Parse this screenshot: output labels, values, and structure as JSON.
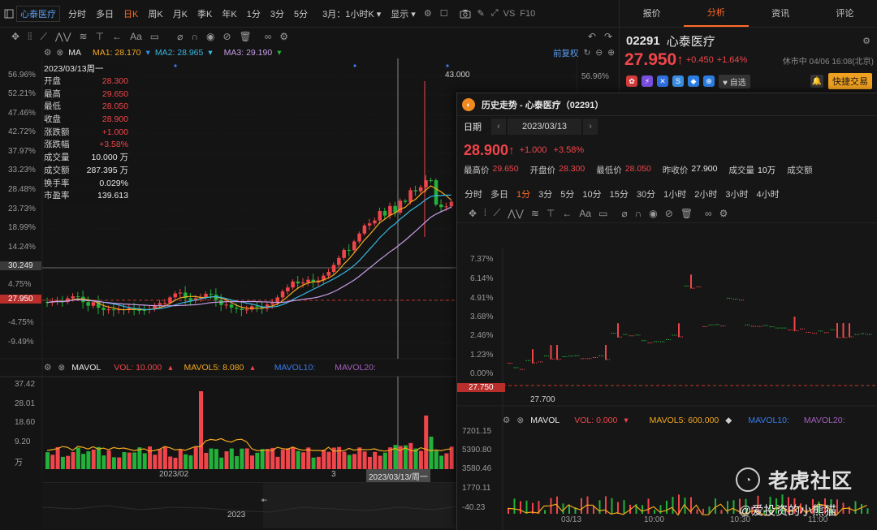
{
  "toolbar": {
    "stock_name": "心泰医疗",
    "periods": [
      "分时",
      "多日",
      "日K",
      "周K",
      "月K",
      "季K",
      "年K",
      "1分",
      "3分",
      "5分"
    ],
    "active_period": "日K",
    "range_select": "3月：1小时K",
    "display_label": "显示",
    "vs_label": "VS",
    "f10_label": "F10"
  },
  "indicators": {
    "ma_label": "MA",
    "ma1": "MA1: 28.170",
    "ma2": "MA2: 28.965",
    "ma3": "MA3: 29.190",
    "restore_label": "前复权"
  },
  "ohlc_panel": {
    "date": "2023/03/13周一",
    "rows": [
      {
        "label": "开盘",
        "value": "28.300",
        "color": "red"
      },
      {
        "label": "最高",
        "value": "29.650",
        "color": "red"
      },
      {
        "label": "最低",
        "value": "28.050",
        "color": "red"
      },
      {
        "label": "收盘",
        "value": "28.900",
        "color": "red"
      },
      {
        "label": "涨跌额",
        "value": "+1.000",
        "color": "red"
      },
      {
        "label": "涨跌幅",
        "value": "+3.58%",
        "color": "red"
      },
      {
        "label": "成交量",
        "value": "10.000 万",
        "color": "white"
      },
      {
        "label": "成交额",
        "value": "287.395 万",
        "color": "white"
      },
      {
        "label": "换手率",
        "value": "0.029%",
        "color": "white"
      },
      {
        "label": "市盈率",
        "value": "139.613",
        "color": "white"
      }
    ]
  },
  "price_axis": [
    "56.96%",
    "52.21%",
    "47.46%",
    "42.72%",
    "37.97%",
    "33.23%",
    "28.48%",
    "23.73%",
    "18.99%",
    "14.24%",
    "30.249",
    "4.75%",
    "27.950",
    "-4.75%",
    "-9.49%"
  ],
  "right_axis_top": "56.96%",
  "high_marker": "43.000",
  "volume": {
    "label": "MAVOL",
    "vol": "VOL: 10.000",
    "mavol5": "MAVOL5: 8.080",
    "mavol10": "MAVOL10:",
    "mavol20": "MAVOL20:",
    "axis": [
      "37.42",
      "28.01",
      "18.60",
      "9.20",
      "万"
    ]
  },
  "time_axis": {
    "t1": "2023/02",
    "t2": "3",
    "t3": "2023/03/13/周一",
    "year": "2023"
  },
  "right_panel": {
    "tabs": [
      "报价",
      "分析",
      "资讯",
      "评论"
    ],
    "active_tab": "分析",
    "code": "02291",
    "name": "心泰医疗",
    "price": "27.950",
    "arrow": "↑",
    "change": "+0.450",
    "change_pct": "+1.64%",
    "status": "休市中 04/06 16:08(北京)",
    "watch_label": "自选",
    "trade_label": "快捷交易"
  },
  "popup": {
    "title": "历史走势 - 心泰医疗（02291）",
    "date_label": "日期",
    "date": "2023/03/13",
    "price": "28.900",
    "arrow": "↑",
    "change": "+1.000",
    "change_pct": "+3.58%",
    "stats": [
      {
        "label": "最高价",
        "value": "29.650",
        "color": "red"
      },
      {
        "label": "开盘价",
        "value": "28.300",
        "color": "red"
      },
      {
        "label": "最低价",
        "value": "28.050",
        "color": "red"
      },
      {
        "label": "昨收价",
        "value": "27.900",
        "color": "white"
      },
      {
        "label": "成交量",
        "value": "10万",
        "color": "white"
      },
      {
        "label": "成交额",
        "value": "",
        "color": "white"
      }
    ],
    "periods": [
      "分时",
      "多日",
      "1分",
      "3分",
      "5分",
      "10分",
      "15分",
      "30分",
      "1小时",
      "2小时",
      "3小时",
      "4小时"
    ],
    "active_period": "1分",
    "axis": [
      "7.37%",
      "6.14%",
      "4.91%",
      "3.68%",
      "2.46%",
      "1.23%",
      "0.00%",
      "27.750"
    ],
    "low_marker": "27.700",
    "vol_label": "MAVOL",
    "vol": "VOL: 0.000",
    "mavol5": "MAVOL5: 600.000",
    "mavol10": "MAVOL10:",
    "mavol20": "MAVOL20:",
    "vol_axis": [
      "7201.15",
      "5390.80",
      "3580.46",
      "1770.11",
      "-40.23"
    ],
    "time_labels": [
      "03/13",
      "10:00",
      "10:30",
      "11:00"
    ]
  },
  "watermark": {
    "brand": "老虎社区",
    "user": "@爱投资的小熊猫"
  }
}
